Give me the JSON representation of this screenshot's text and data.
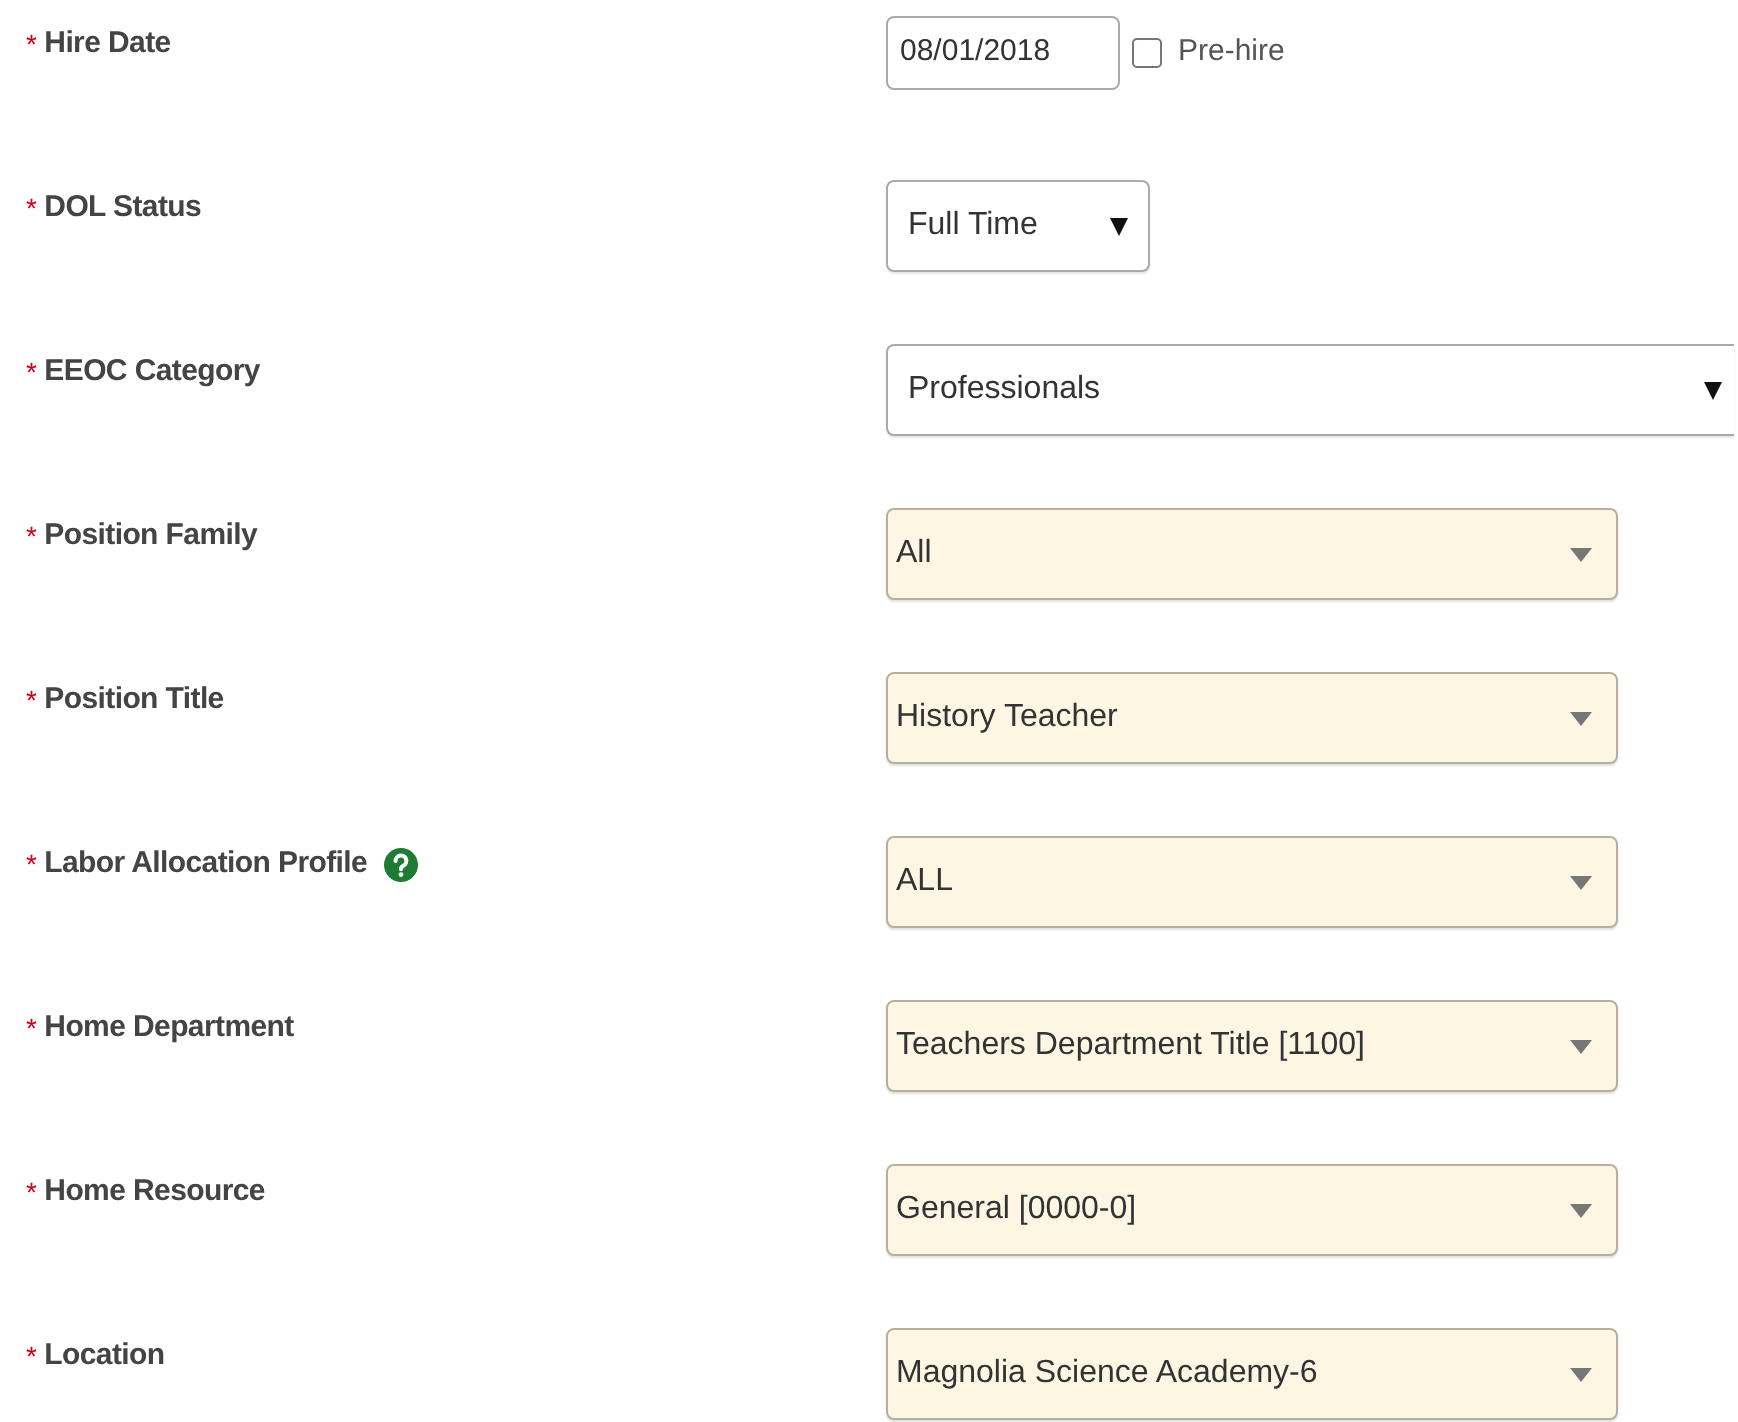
{
  "fields": [
    {
      "label": "Hire Date",
      "required_mark": "*",
      "kind": "date",
      "value": "08/01/2018",
      "checkbox": {
        "label": "Pre-hire",
        "checked": false
      }
    },
    {
      "label": "DOL Status",
      "required_mark": "*",
      "kind": "select",
      "value": "Full Time"
    },
    {
      "label": "EEOC Category",
      "required_mark": "*",
      "kind": "wide-select",
      "value": "Professionals"
    },
    {
      "label": "Position Family",
      "required_mark": "*",
      "kind": "combo",
      "value": "All"
    },
    {
      "label": "Position Title",
      "required_mark": "*",
      "kind": "combo",
      "value": "History Teacher"
    },
    {
      "label": "Labor Allocation Profile",
      "required_mark": "*",
      "kind": "combo",
      "value": "ALL",
      "help": true
    },
    {
      "label": "Home Department",
      "required_mark": "*",
      "kind": "combo",
      "value": "Teachers Department Title [1100]"
    },
    {
      "label": "Home Resource",
      "required_mark": "*",
      "kind": "combo",
      "value": "General [0000-0]"
    },
    {
      "label": "Location",
      "required_mark": "*",
      "kind": "combo",
      "value": "Magnolia Science Academy-6"
    }
  ]
}
